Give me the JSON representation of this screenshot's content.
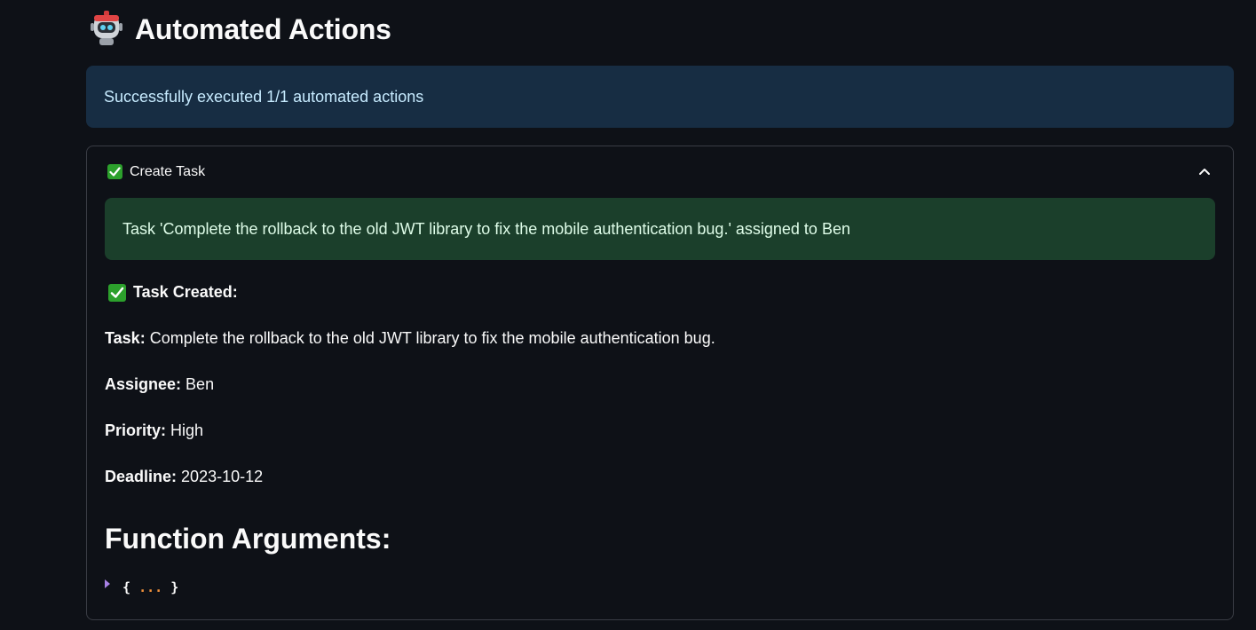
{
  "header": {
    "title": "Automated Actions",
    "icon": "robot-icon"
  },
  "info_alert": {
    "text": "Successfully executed 1/1 automated actions"
  },
  "expander": {
    "label": "Create Task",
    "state": "expanded",
    "success_alert": "Task 'Complete the rollback to the old JWT library to fix the mobile authentication bug.' assigned to Ben",
    "created_label": "Task Created:",
    "fields": [
      {
        "label": "Task:",
        "value": "Complete the rollback to the old JWT library to fix the mobile authentication bug."
      },
      {
        "label": "Assignee:",
        "value": "Ben"
      },
      {
        "label": "Priority:",
        "value": "High"
      },
      {
        "label": "Deadline:",
        "value": "2023-10-12"
      }
    ],
    "section_title": "Function Arguments:",
    "json": {
      "open": "{",
      "dots": "...",
      "close": "}"
    }
  },
  "colors": {
    "background": "#0e1117",
    "info_bg": "#172d43",
    "success_bg": "#1b3f2b",
    "check_green": "#2ca02c",
    "json_dots": "#f0903a"
  }
}
